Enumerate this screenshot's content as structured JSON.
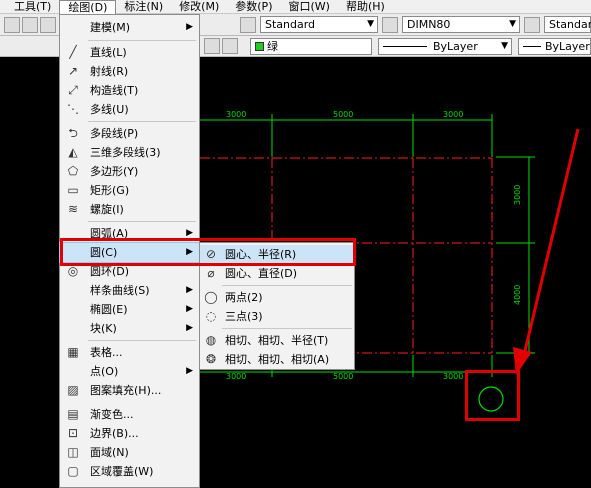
{
  "menubar": {
    "items": [
      {
        "label": "工具(T)"
      },
      {
        "label": "绘图(D)"
      },
      {
        "label": "标注(N)"
      },
      {
        "label": "修改(M)"
      },
      {
        "label": "参数(P)"
      },
      {
        "label": "窗口(W)"
      },
      {
        "label": "帮助(H)"
      }
    ],
    "active_index": 1
  },
  "toolbar1": {
    "text_style": "Standard",
    "dim_style": "DIMN80",
    "table_style": "Standard"
  },
  "toolbar2": {
    "layer_color": "绿",
    "linetype": "ByLayer",
    "lineweight": "ByLayer"
  },
  "draw_menu": {
    "items": [
      {
        "label": "建模(M)",
        "icon": "none",
        "submenu": true
      },
      {
        "label": "直线(L)",
        "icon": "line-icon"
      },
      {
        "label": "射线(R)",
        "icon": "ray-icon"
      },
      {
        "label": "构造线(T)",
        "icon": "xline-icon"
      },
      {
        "label": "多线(U)",
        "icon": "multiline-icon"
      },
      {
        "label": "多段线(P)",
        "icon": "polyline-icon"
      },
      {
        "label": "三维多段线(3)",
        "icon": "3dpoly-icon"
      },
      {
        "label": "多边形(Y)",
        "icon": "polygon-icon"
      },
      {
        "label": "矩形(G)",
        "icon": "rectangle-icon"
      },
      {
        "label": "螺旋(I)",
        "icon": "helix-icon"
      },
      {
        "label": "圆弧(A)",
        "icon": "none",
        "submenu": true
      },
      {
        "label": "圆(C)",
        "icon": "none",
        "submenu": true
      },
      {
        "label": "圆环(D)",
        "icon": "donut-icon"
      },
      {
        "label": "样条曲线(S)",
        "icon": "none",
        "submenu": true
      },
      {
        "label": "椭圆(E)",
        "icon": "none",
        "submenu": true
      },
      {
        "label": "块(K)",
        "icon": "none",
        "submenu": true
      },
      {
        "label": "表格...",
        "icon": "table-icon"
      },
      {
        "label": "点(O)",
        "icon": "none",
        "submenu": true
      },
      {
        "label": "图案填充(H)...",
        "icon": "hatch-icon"
      },
      {
        "label": "渐变色...",
        "icon": "gradient-icon"
      },
      {
        "label": "边界(B)...",
        "icon": "boundary-icon"
      },
      {
        "label": "面域(N)",
        "icon": "region-icon"
      },
      {
        "label": "区域覆盖(W)",
        "icon": "wipeout-icon"
      }
    ],
    "highlighted_index": 11
  },
  "circle_submenu": {
    "items": [
      {
        "label": "圆心、半径(R)",
        "icon": "circle-center-radius-icon"
      },
      {
        "label": "圆心、直径(D)",
        "icon": "circle-center-diameter-icon"
      },
      {
        "label": "两点(2)",
        "icon": "circle-2point-icon"
      },
      {
        "label": "三点(3)",
        "icon": "circle-3point-icon"
      },
      {
        "label": "相切、相切、半径(T)",
        "icon": "circle-ttr-icon"
      },
      {
        "label": "相切、相切、相切(A)",
        "icon": "circle-ttt-icon"
      }
    ],
    "highlighted_index": 0
  },
  "drawing": {
    "dims_top": [
      "3000",
      "5000",
      "3000"
    ],
    "dims_bottom": [
      "3000",
      "5000",
      "3000"
    ],
    "dims_right": [
      "3000",
      "4000"
    ]
  },
  "colors": {
    "accent_red": "#e00000",
    "dim_green": "#00dd00",
    "grid_red": "#ff2020",
    "highlight": "#cce4f7"
  }
}
